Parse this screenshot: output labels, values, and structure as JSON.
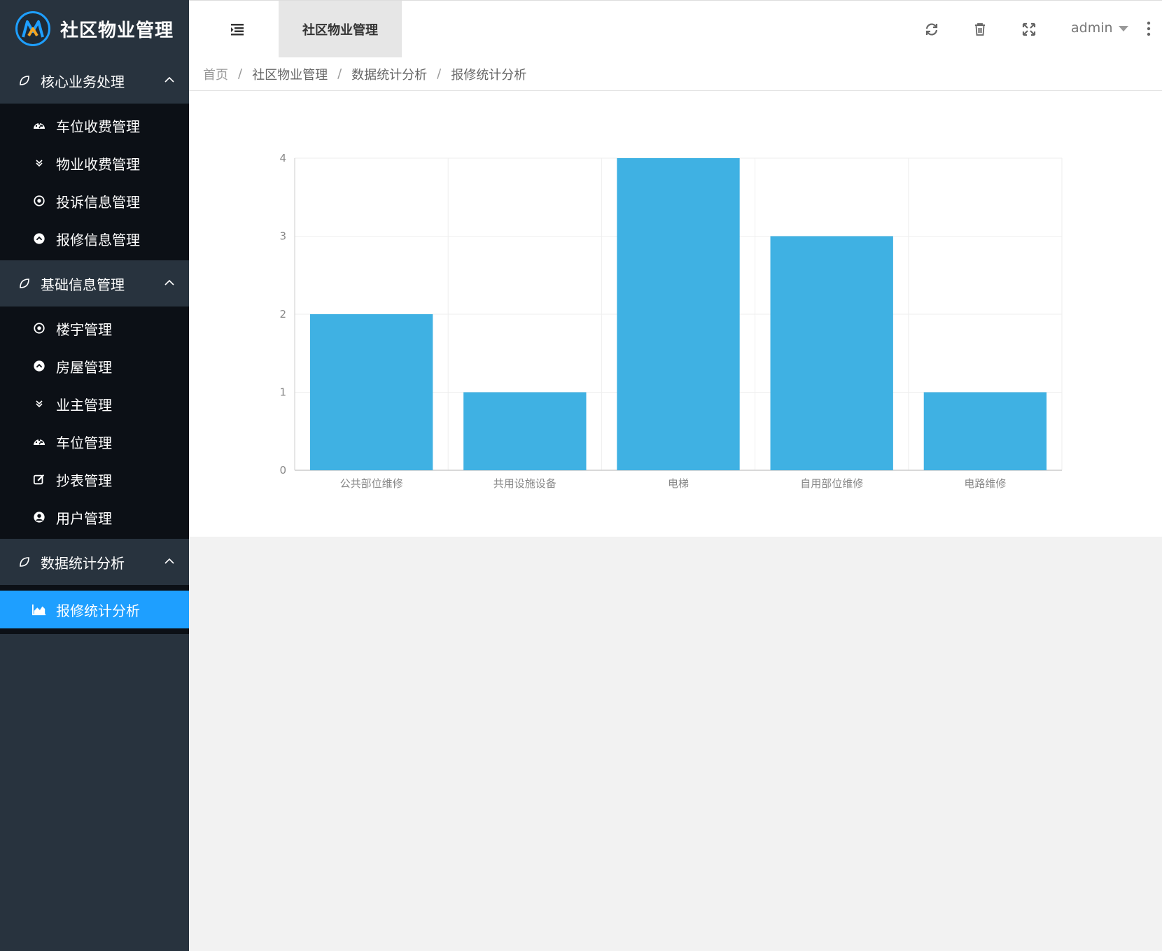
{
  "app": {
    "title": "社区物业管理"
  },
  "sidebar": {
    "groups": [
      {
        "label": "核心业务处理",
        "items": [
          {
            "label": "车位收费管理",
            "icon": "dashboard-icon"
          },
          {
            "label": "物业收费管理",
            "icon": "double-chevron-down-icon"
          },
          {
            "label": "投诉信息管理",
            "icon": "dot-circle-icon"
          },
          {
            "label": "报修信息管理",
            "icon": "chevron-circle-up-icon"
          }
        ]
      },
      {
        "label": "基础信息管理",
        "items": [
          {
            "label": "楼宇管理",
            "icon": "dot-circle-icon"
          },
          {
            "label": "房屋管理",
            "icon": "chevron-circle-up-icon"
          },
          {
            "label": "业主管理",
            "icon": "double-chevron-down-icon"
          },
          {
            "label": "车位管理",
            "icon": "dashboard-icon"
          },
          {
            "label": "抄表管理",
            "icon": "edit-icon"
          },
          {
            "label": "用户管理",
            "icon": "user-circle-icon"
          }
        ]
      },
      {
        "label": "数据统计分析",
        "items": [
          {
            "label": "报修统计分析",
            "icon": "area-chart-icon",
            "active": true
          }
        ]
      }
    ]
  },
  "header": {
    "tab_label": "社区物业管理",
    "user": "admin"
  },
  "breadcrumb": [
    "首页",
    "社区物业管理",
    "数据统计分析",
    "报修统计分析"
  ],
  "colors": {
    "accent": "#1e9fff",
    "bar": "#3fb1e3",
    "sidebar": "#28333e",
    "sidebar_dark": "#0c1016"
  },
  "chart_data": {
    "type": "bar",
    "categories": [
      "公共部位维修",
      "共用设施设备",
      "电梯",
      "自用部位维修",
      "电路维修"
    ],
    "values": [
      2,
      1,
      4,
      3,
      1
    ],
    "ylim": [
      0,
      4
    ],
    "yticks": [
      0,
      1,
      2,
      3,
      4
    ],
    "grid": true
  }
}
